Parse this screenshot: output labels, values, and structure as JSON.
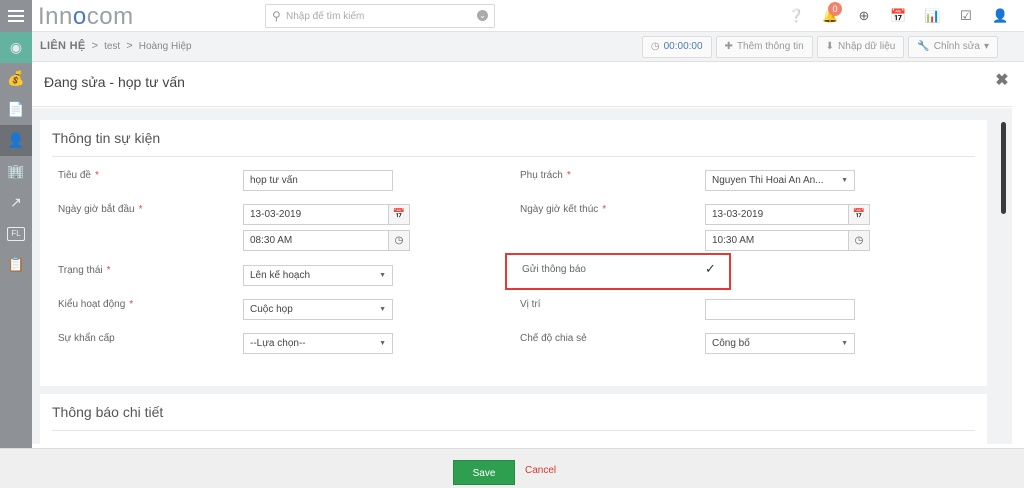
{
  "app": {
    "logo_prefix": "Inn",
    "logo_o": "o",
    "logo_suffix": "com",
    "search_placeholder": "Nhập để tìm kiếm",
    "notification_count": "0"
  },
  "breadcrumb": {
    "root": "LIÊN HỆ",
    "items": [
      "test",
      "Hoàng Hiệp"
    ]
  },
  "toolbar": {
    "timer": "00:00:00",
    "add_info": "Thêm thông tin",
    "import_data": "Nhập dữ liệu",
    "edit": "Chỉnh sửa"
  },
  "modal": {
    "title": "Đang sửa - họp tư vấn"
  },
  "section_event": {
    "title": "Thông tin sự kiện",
    "title_label": "Tiêu đề",
    "title_value": "họp tư vấn",
    "owner_label": "Phụ trách",
    "owner_value": "Nguyen Thi Hoai An An...",
    "start_label": "Ngày giờ bắt đầu",
    "start_date": "13-03-2019",
    "start_time": "08:30 AM",
    "end_label": "Ngày giờ kết thúc",
    "end_date": "13-03-2019",
    "end_time": "10:30 AM",
    "status_label": "Trạng thái",
    "status_value": "Lên kế hoạch",
    "notify_label": "Gửi thông báo",
    "notify_checked": true,
    "activity_label": "Kiểu hoạt động",
    "activity_value": "Cuộc họp",
    "location_label": "Vị trí",
    "location_value": "",
    "urgency_label": "Sự khẩn cấp",
    "urgency_value": "--Lựa chọn--",
    "share_label": "Chế độ chia sẻ",
    "share_value": "Công bố"
  },
  "section_notify": {
    "title": "Thông báo chi tiết"
  },
  "footer": {
    "save": "Save",
    "cancel": "Cancel"
  },
  "colors": {
    "sidebar": "#8e9296",
    "sidebar_active_top": "#63b3a0",
    "save_button": "#2e9f4e",
    "cancel_link": "#d9382c",
    "required_star": "#e04545",
    "highlight_box": "#e53935"
  }
}
